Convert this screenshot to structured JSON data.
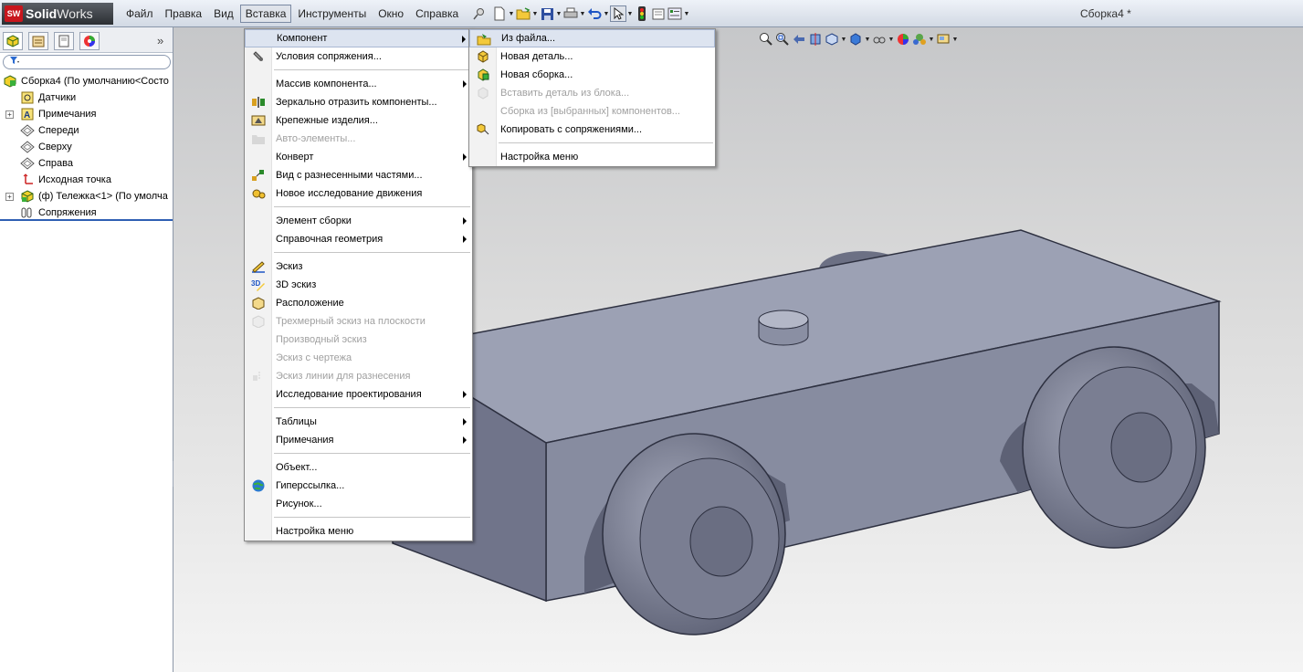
{
  "app": {
    "logo_sw": "SW",
    "logo_solid": "Solid",
    "logo_works": "Works",
    "document_title": "Сборка4 *"
  },
  "menubar": {
    "items": [
      "Файл",
      "Правка",
      "Вид",
      "Вставка",
      "Инструменты",
      "Окно",
      "Справка"
    ],
    "active": "Вставка"
  },
  "feature_tree": {
    "filter_icon": "filter-icon",
    "nodes": [
      {
        "label": "Сборка4  (По умолчанию<Состо",
        "icon": "assembly-icon",
        "expand": false,
        "indent": 0
      },
      {
        "label": "Датчики",
        "icon": "sensor-icon",
        "expand": false,
        "indent": 1
      },
      {
        "label": "Примечания",
        "icon": "annotation-icon",
        "expand": true,
        "indent": 1
      },
      {
        "label": "Спереди",
        "icon": "plane-icon",
        "expand": false,
        "indent": 1
      },
      {
        "label": "Сверху",
        "icon": "plane-icon",
        "expand": false,
        "indent": 1
      },
      {
        "label": "Справа",
        "icon": "plane-icon",
        "expand": false,
        "indent": 1
      },
      {
        "label": "Исходная точка",
        "icon": "origin-icon",
        "expand": false,
        "indent": 1
      },
      {
        "label": "(ф) Тележка<1> (По умолча",
        "icon": "part-icon",
        "expand": true,
        "indent": 1
      },
      {
        "label": "Сопряжения",
        "icon": "mates-icon",
        "expand": false,
        "indent": 1
      }
    ]
  },
  "insert_menu": {
    "items": [
      {
        "type": "item",
        "label": "Компонент",
        "submenu": true,
        "disabled": false,
        "highlighted": true,
        "icon": ""
      },
      {
        "type": "item",
        "label": "Условия сопряжения...",
        "submenu": false,
        "disabled": false,
        "icon": "mate-icon"
      },
      {
        "type": "sep"
      },
      {
        "type": "item",
        "label": "Массив компонента...",
        "submenu": true,
        "disabled": false,
        "icon": ""
      },
      {
        "type": "item",
        "label": "Зеркально отразить компоненты...",
        "submenu": false,
        "disabled": false,
        "icon": "mirror-icon"
      },
      {
        "type": "item",
        "label": "Крепежные изделия...",
        "submenu": false,
        "disabled": false,
        "icon": "fastener-icon"
      },
      {
        "type": "item",
        "label": "Авто-элементы...",
        "submenu": false,
        "disabled": true,
        "icon": "folder-icon"
      },
      {
        "type": "item",
        "label": "Конверт",
        "submenu": true,
        "disabled": false,
        "icon": ""
      },
      {
        "type": "item",
        "label": "Вид с разнесенными частями...",
        "submenu": false,
        "disabled": false,
        "icon": "explode-icon"
      },
      {
        "type": "item",
        "label": "Новое исследование движения",
        "submenu": false,
        "disabled": false,
        "icon": "motion-icon"
      },
      {
        "type": "sep"
      },
      {
        "type": "item",
        "label": "Элемент сборки",
        "submenu": true,
        "disabled": false,
        "icon": ""
      },
      {
        "type": "item",
        "label": "Справочная геометрия",
        "submenu": true,
        "disabled": false,
        "icon": ""
      },
      {
        "type": "sep"
      },
      {
        "type": "item",
        "label": "Эскиз",
        "submenu": false,
        "disabled": false,
        "icon": "sketch-icon"
      },
      {
        "type": "item",
        "label": "3D эскиз",
        "submenu": false,
        "disabled": false,
        "icon": "sketch-3d-icon"
      },
      {
        "type": "item",
        "label": "Расположение",
        "submenu": false,
        "disabled": false,
        "icon": "layout-icon"
      },
      {
        "type": "item",
        "label": "Трехмерный эскиз на плоскости",
        "submenu": false,
        "disabled": true,
        "icon": "sketch-plane-icon"
      },
      {
        "type": "item",
        "label": "Производный эскиз",
        "submenu": false,
        "disabled": true,
        "icon": ""
      },
      {
        "type": "item",
        "label": "Эскиз с чертежа",
        "submenu": false,
        "disabled": true,
        "icon": ""
      },
      {
        "type": "item",
        "label": "Эскиз линии для разнесения",
        "submenu": false,
        "disabled": true,
        "icon": "explode-line-icon"
      },
      {
        "type": "item",
        "label": "Исследование проектирования",
        "submenu": true,
        "disabled": false,
        "icon": ""
      },
      {
        "type": "sep"
      },
      {
        "type": "item",
        "label": "Таблицы",
        "submenu": true,
        "disabled": false,
        "icon": ""
      },
      {
        "type": "item",
        "label": "Примечания",
        "submenu": true,
        "disabled": false,
        "icon": ""
      },
      {
        "type": "sep"
      },
      {
        "type": "item",
        "label": "Объект...",
        "submenu": false,
        "disabled": false,
        "icon": ""
      },
      {
        "type": "item",
        "label": "Гиперссылка...",
        "submenu": false,
        "disabled": false,
        "icon": "globe-icon"
      },
      {
        "type": "item",
        "label": "Рисунок...",
        "submenu": false,
        "disabled": false,
        "icon": ""
      },
      {
        "type": "sep"
      },
      {
        "type": "item",
        "label": "Настройка меню",
        "submenu": false,
        "disabled": false,
        "icon": ""
      }
    ]
  },
  "component_submenu": {
    "items": [
      {
        "type": "item",
        "label": "Из файла...",
        "disabled": false,
        "highlighted": true,
        "icon": "open-file-icon"
      },
      {
        "type": "item",
        "label": "Новая деталь...",
        "disabled": false,
        "icon": "new-part-icon"
      },
      {
        "type": "item",
        "label": "Новая сборка...",
        "disabled": false,
        "icon": "new-assembly-icon"
      },
      {
        "type": "item",
        "label": "Вставить деталь из блока...",
        "disabled": true,
        "icon": "block-part-icon"
      },
      {
        "type": "item",
        "label": "Сборка из [выбранных] компонентов...",
        "disabled": true,
        "icon": ""
      },
      {
        "type": "item",
        "label": "Копировать с сопряжениями...",
        "disabled": false,
        "icon": "copy-mates-icon"
      },
      {
        "type": "sep"
      },
      {
        "type": "item",
        "label": "Настройка меню",
        "disabled": false,
        "icon": ""
      }
    ]
  },
  "colors": {
    "model_body": "#8a8fa3",
    "model_top": "#9ba0b3",
    "model_dark": "#4f5366",
    "accent": "#2f5fb3"
  }
}
